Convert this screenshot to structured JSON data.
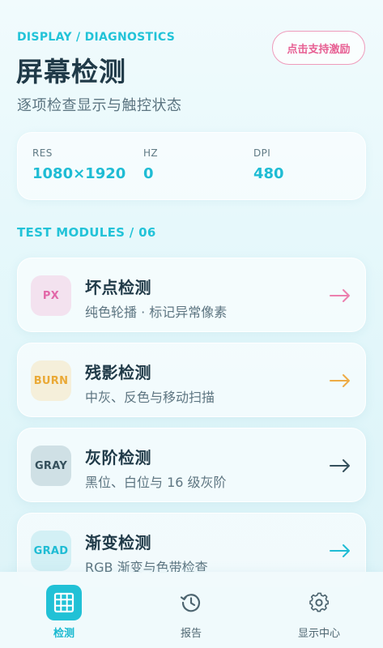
{
  "header": {
    "breadcrumb": "DISPLAY / DIAGNOSTICS",
    "title": "屏幕检测",
    "subtitle": "逐项检查显示与触控状态",
    "support_label": "点击支持激励"
  },
  "stats": [
    {
      "label": "RES",
      "value": "1080×1920"
    },
    {
      "label": "HZ",
      "value": "0"
    },
    {
      "label": "DPI",
      "value": "480"
    }
  ],
  "section": {
    "label": "TEST MODULES / 06"
  },
  "modules": [
    {
      "badge": "PX",
      "title": "坏点检测",
      "desc": "纯色轮播 · 标记异常像素",
      "badge_bg": "#f3e2ef",
      "badge_fg": "#e267a8",
      "arrow_color": "#ec7fae"
    },
    {
      "badge": "BURN",
      "title": "残影检测",
      "desc": "中灰、反色与移动扫描",
      "badge_bg": "#f5efda",
      "badge_fg": "#eaa936",
      "arrow_color": "#eeab45"
    },
    {
      "badge": "GRAY",
      "title": "灰阶检测",
      "desc": "黑位、白位与 16 级灰阶",
      "badge_bg": "#cfe0e5",
      "badge_fg": "#35505c",
      "arrow_color": "#35505c"
    },
    {
      "badge": "GRAD",
      "title": "渐变检测",
      "desc": "RGB 渐变与色带检查",
      "badge_bg": "#d3f0f5",
      "badge_fg": "#1fbcd4",
      "arrow_color": "#1fbcd4"
    }
  ],
  "nav": [
    {
      "label": "检测",
      "icon": "grid-icon",
      "active": true
    },
    {
      "label": "报告",
      "icon": "history-icon",
      "active": false
    },
    {
      "label": "显示中心",
      "icon": "gear-icon",
      "active": false
    }
  ],
  "colors": {
    "accent": "#21c1d6",
    "title": "#203a48",
    "support": "#e75f93"
  }
}
